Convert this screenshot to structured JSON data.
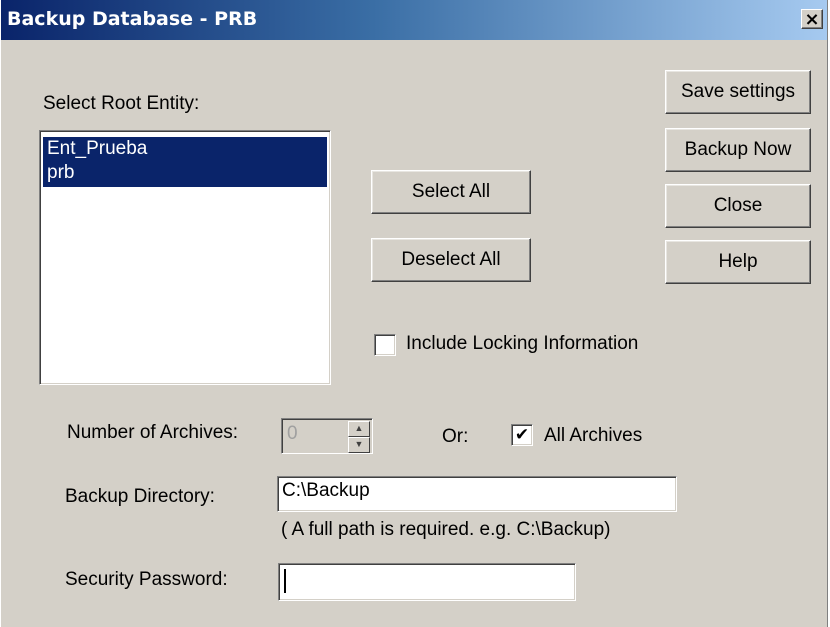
{
  "window": {
    "title": "Backup Database - PRB",
    "close_glyph": "×"
  },
  "root_entity": {
    "label": "Select Root Entity:",
    "items": [
      "Ent_Prueba",
      "prb"
    ]
  },
  "buttons": {
    "save_settings": "Save settings",
    "backup_now": "Backup Now",
    "close": "Close",
    "help": "Help",
    "select_all": "Select All",
    "deselect_all": "Deselect All"
  },
  "locking": {
    "label": "Include Locking Information",
    "checked": false
  },
  "archives": {
    "label": "Number of Archives:",
    "value": "0",
    "or_label": "Or:",
    "all_label": "All Archives",
    "all_checked": true,
    "check_glyph": "✔"
  },
  "backup_directory": {
    "label": "Backup Directory:",
    "value": "C:\\Backup",
    "hint": "( A full path is required. e.g. C:\\Backup)"
  },
  "password": {
    "label": "Security Password:",
    "value": ""
  }
}
